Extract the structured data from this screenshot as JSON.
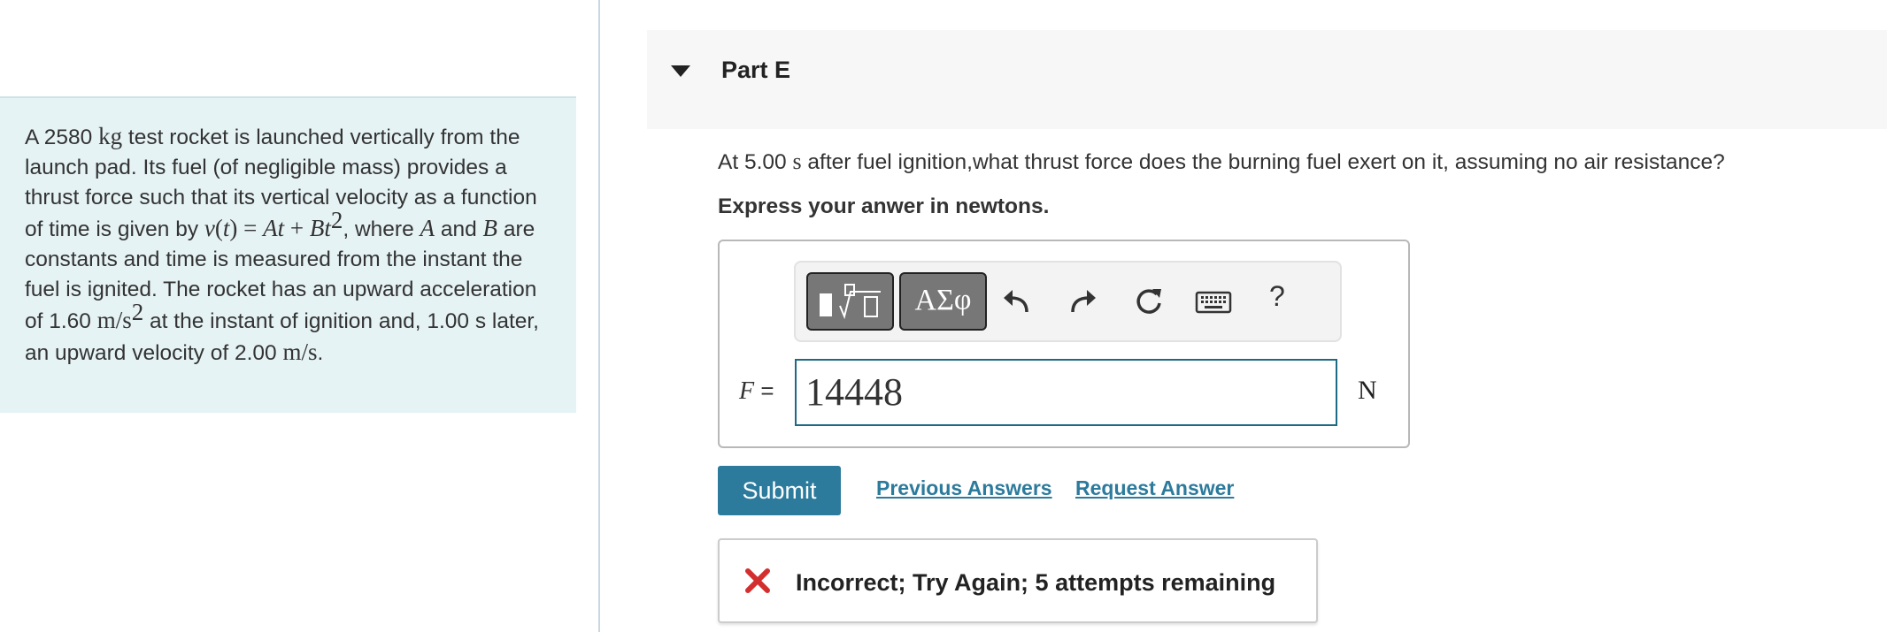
{
  "problem": {
    "t1": "A 2580 ",
    "kg": "kg",
    "t2": " test rocket is launched vertically from the launch pad. Its fuel (of negligible mass) provides a thrust force such that its vertical velocity as a function of time is given by ",
    "v": "v",
    "t3": "(",
    "tvar": "t",
    "t4": ") = ",
    "A": "A",
    "t5": "t",
    "t6": " + ",
    "B": "B",
    "t7": "t",
    "sq": "2",
    "t8": ", where ",
    "A2": "A",
    "t9": " and ",
    "B2": "B",
    "t10": " are constants and time is measured from the instant the fuel is ignited. The rocket has an upward acceleration of 1.60 ",
    "accel_unit": "m/s",
    "sq2": "2",
    "t11": " at the instant of ignition and, 1.00 s later, an upward velocity of 2.00 ",
    "vel_unit": "m/s",
    "t12": "."
  },
  "part": {
    "title": "Part E"
  },
  "question": {
    "t1": "At 5.00 ",
    "unit": "s",
    "t2": " after fuel ignition,what thrust force does the burning fuel exert on it, assuming no air resistance?"
  },
  "instruction": "Express your anwer in newtons.",
  "toolbar": {
    "symbols_label": "ΑΣφ",
    "help_label": "?"
  },
  "answer": {
    "variable": "F",
    "equals": " =",
    "value": "14448",
    "unit": "N"
  },
  "actions": {
    "submit": "Submit",
    "previous_answers": "Previous Answers",
    "request_answer": "Request Answer"
  },
  "feedback": {
    "message": "Incorrect; Try Again; 5 attempts remaining",
    "icon": "x-mark-icon",
    "color": "#d32f2f"
  },
  "colors": {
    "accent": "#2c7a9c",
    "panel_bg": "#e6f3f5"
  }
}
